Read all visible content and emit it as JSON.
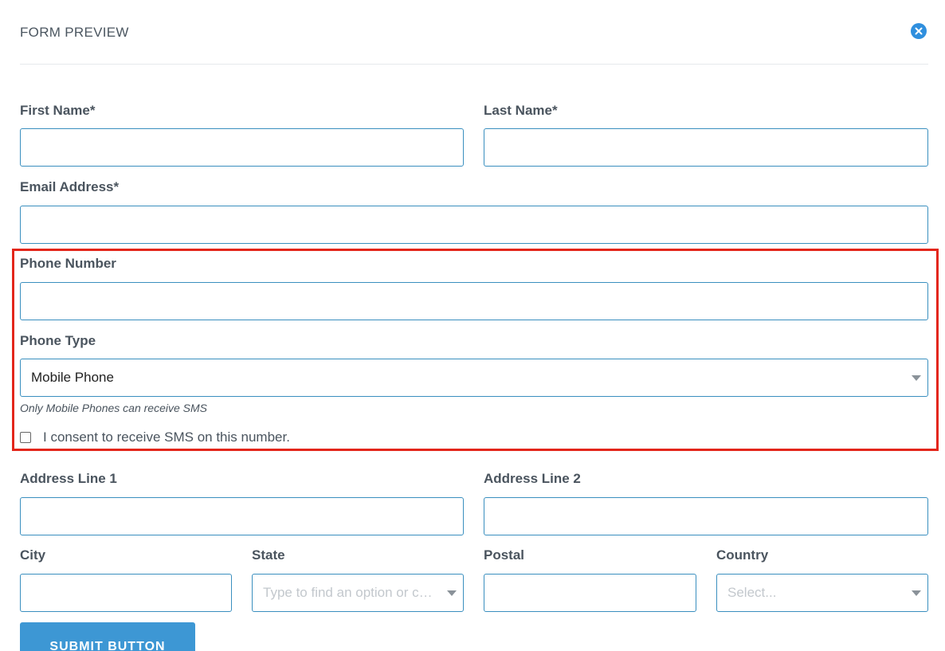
{
  "header": {
    "title": "FORM PREVIEW",
    "close_icon": "close-icon"
  },
  "fields": {
    "first_name": {
      "label": "First Name*",
      "value": ""
    },
    "last_name": {
      "label": "Last Name*",
      "value": ""
    },
    "email": {
      "label": "Email Address*",
      "value": ""
    },
    "phone_number": {
      "label": "Phone Number",
      "value": ""
    },
    "phone_type": {
      "label": "Phone Type",
      "value": "Mobile Phone"
    },
    "phone_hint": "Only Mobile Phones can receive SMS",
    "sms_consent": {
      "label": "I consent to receive SMS on this number.",
      "checked": false
    },
    "address1": {
      "label": "Address Line 1",
      "value": ""
    },
    "address2": {
      "label": "Address Line 2",
      "value": ""
    },
    "city": {
      "label": "City",
      "value": ""
    },
    "state": {
      "label": "State",
      "placeholder": "Type to find an option or crea..."
    },
    "postal": {
      "label": "Postal",
      "value": ""
    },
    "country": {
      "label": "Country",
      "placeholder": "Select..."
    }
  },
  "submit": {
    "label": "SUBMIT BUTTON"
  },
  "colors": {
    "accent": "#3d97d4",
    "input_border": "#3a8fbf",
    "highlight": "#e3261b"
  }
}
